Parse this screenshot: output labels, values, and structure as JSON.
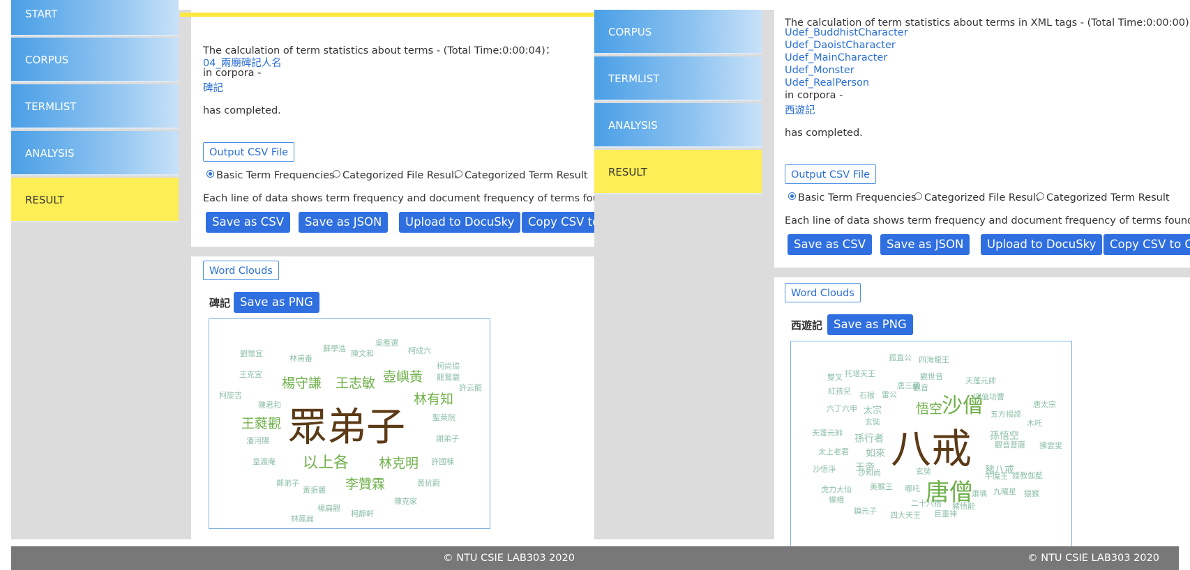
{
  "left": {
    "nav": [
      "START",
      "CORPUS",
      "TERMLIST",
      "ANALYSIS",
      "RESULT"
    ],
    "heading": "The calculation of term statistics about terms - (Total Time:0:00:04)：",
    "terms": [
      "04_兩廟碑記人名"
    ],
    "in_corpora": "in corpora -",
    "corpus": "碑記",
    "completed": "has completed.",
    "output_csv": "Output CSV File",
    "radios": [
      {
        "label": "Basic Term Frequencies",
        "checked": true
      },
      {
        "label": "Categorized File Result",
        "checked": false
      },
      {
        "label": "Categorized Term Result",
        "checked": false
      }
    ],
    "desc": "Each line of data shows term frequency and document frequency of terms found.",
    "buttons": [
      "Save as CSV",
      "Save as JSON",
      "Upload to DocuSky",
      "Copy CSV to Clipboard"
    ],
    "word_clouds": "Word Clouds",
    "cloud_title": "碑記",
    "save_png": "Save as PNG",
    "cloud_words": [
      "眾弟子",
      "以上各",
      "林克明",
      "李贊霖",
      "王蕤觀",
      "楊守謙",
      "王志敏",
      "壺嶼黃",
      "林有知",
      "劉懷宜",
      "林甫番",
      "蘇學浩",
      "陳文和",
      "吳應選",
      "柯成六",
      "柯尚協",
      "龍鷲巖",
      "王克宜",
      "許云龍",
      "柯旋吉",
      "陳君和",
      "聖萊院",
      "潘河陽",
      "謝弟子",
      "皇渡庵",
      "許國棟",
      "鄭弟子",
      "黃振麗",
      "黃抗觀",
      "陳克家",
      "楊扁觀",
      "柯靜軒",
      "林鳳扁"
    ],
    "footer": "© NTU CSIE LAB303 2020"
  },
  "right": {
    "nav": [
      "CORPUS",
      "TERMLIST",
      "ANALYSIS",
      "RESULT"
    ],
    "heading": "The calculation of term statistics about terms in XML tags - (Total Time:0:00:00)：",
    "tags": [
      "Udef_BuddhistCharacter",
      "Udef_DaoistCharacter",
      "Udef_MainCharacter",
      "Udef_Monster",
      "Udef_RealPerson"
    ],
    "in_corpora": "in corpora -",
    "corpus": "西遊記",
    "completed": "has completed.",
    "output_csv": "Output CSV File",
    "radios": [
      {
        "label": "Basic Term Frequencies",
        "checked": true
      },
      {
        "label": "Categorized File Result",
        "checked": false
      },
      {
        "label": "Categorized Term Result",
        "checked": false
      }
    ],
    "desc": "Each line of data shows term frequency and document frequency of terms found.",
    "buttons": [
      "Save as CSV",
      "Save as JSON",
      "Upload to DocuSky",
      "Copy CSV to Clipboard"
    ],
    "word_clouds": "Word Clouds",
    "cloud_title": "西遊記",
    "save_png": "Save as PNG",
    "cloud_words": [
      "八戒",
      "唐僧",
      "沙僧",
      "悟空",
      "孫行者",
      "如來",
      "玉帝",
      "孫悟空",
      "豬八戒",
      "太宗",
      "孤直公",
      "四海龍王",
      "托塔天王",
      "觀世音",
      "天蓬元帥",
      "雙叉",
      "唐三藏",
      "觀音",
      "紅孩兒",
      "石猴",
      "雷公",
      "四值功曹",
      "唐太宗",
      "六丁六甲",
      "五方揭諦",
      "玄奘",
      "木吒",
      "天蓬元帥",
      "觀音菩薩",
      "拂雲叟",
      "太上老君",
      "沙悟淨",
      "沙和尚",
      "牛魔王",
      "護教伽藍",
      "虎力大仙",
      "美猴王",
      "哪吒",
      "蕭瑀",
      "九曜星",
      "猿猴",
      "蝶蛾",
      "二十八宿",
      "豬悟能",
      "鎮元子",
      "四大天王",
      "巨靈神",
      "玄奘"
    ],
    "footer": "© NTU CSIE LAB303 2020"
  },
  "colors": {
    "nav_blue": "#4a9fe6",
    "active_yellow": "#fdee55",
    "button_blue": "#2f6fe0",
    "link_blue": "#2a6fd6",
    "cloud_main": "#5b3a16",
    "cloud_green": "#6fb04a"
  }
}
